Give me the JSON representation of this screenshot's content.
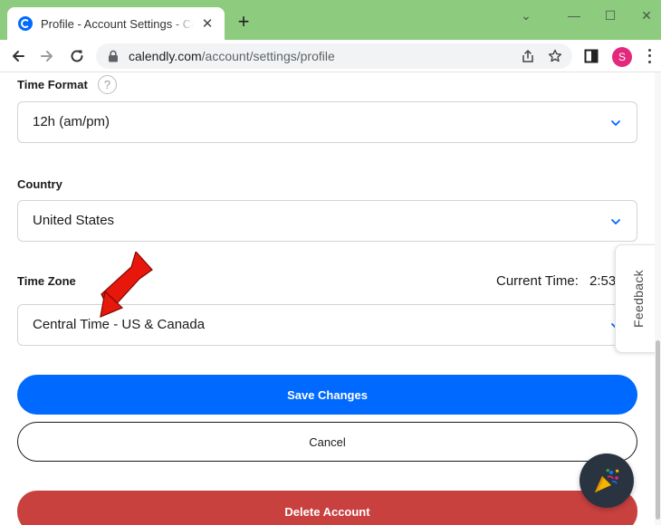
{
  "browser": {
    "tab_title": "Profile - Account Settings - Calendly",
    "tab_close_glyph": "✕",
    "new_tab_glyph": "+",
    "url_host": "calendly.com",
    "url_path": "/account/settings/profile",
    "profile_initial": "S",
    "window_controls": {
      "chevron": "⌄",
      "minimize": "—",
      "maximize": "☐",
      "close": "✕"
    },
    "colors": {
      "frame": "#8dcb7f",
      "avatar": "#e4287c",
      "favicon": "#0069ff"
    }
  },
  "form": {
    "time_format": {
      "label": "Time Format",
      "help": "?",
      "value": "12h (am/pm)"
    },
    "country": {
      "label": "Country",
      "value": "United States"
    },
    "time_zone": {
      "label": "Time Zone",
      "value": "Central Time - US & Canada",
      "current_time_label": "Current Time:",
      "current_time_value": "2:53"
    }
  },
  "buttons": {
    "save": "Save Changes",
    "cancel": "Cancel",
    "delete": "Delete Account"
  },
  "feedback": {
    "label": "Feedback"
  },
  "colors": {
    "primary": "#0069ff",
    "danger": "#c8413f",
    "annotation_arrow": "#e8170c"
  },
  "icons": {
    "back": "back-arrow-icon",
    "forward": "forward-arrow-icon",
    "reload": "reload-icon",
    "lock": "lock-icon",
    "share": "share-icon",
    "bookmark": "star-icon",
    "side_panel": "side-panel-icon",
    "menu": "kebab-menu-icon",
    "chevron": "chevron-down-icon",
    "celebration": "party-popper-icon"
  }
}
